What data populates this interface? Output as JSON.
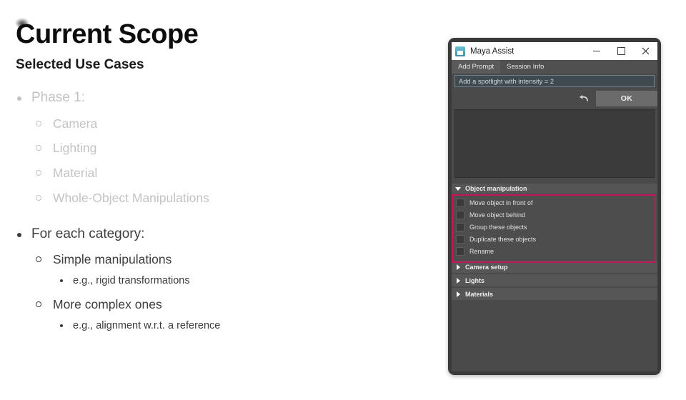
{
  "slide": {
    "title": "Current Scope",
    "subtitle": "Selected Use Cases",
    "bullets": {
      "phase1": {
        "label": "Phase 1:",
        "items": [
          "Camera",
          "Lighting",
          "Material",
          "Whole-Object Manipulations"
        ]
      },
      "each_category": {
        "label": "For each category:",
        "items": [
          {
            "label": "Simple manipulations",
            "sub": "e.g., rigid transformations"
          },
          {
            "label": "More complex ones",
            "sub": "e.g., alignment w.r.t. a reference"
          }
        ]
      }
    }
  },
  "app_window": {
    "title": "Maya Assist",
    "icon": "save-disk-icon",
    "window_controls": {
      "minimize": "minimize-icon",
      "maximize": "maximize-icon",
      "close": "close-icon"
    },
    "tabs": [
      {
        "label": "Add Prompt",
        "active": true
      },
      {
        "label": "Session Info",
        "active": false
      }
    ],
    "prompt_input": {
      "value": "Add a spotlight with intensity = 2",
      "placeholder": "Add a spotlight with intensity = 2"
    },
    "actions": {
      "undo_icon": "undo-arrow-icon",
      "ok_label": "OK"
    },
    "output_log": "",
    "sections": [
      {
        "title": "Object manipulation",
        "expanded": true,
        "highlighted": true,
        "items": [
          "Move object in front of",
          "Move object behind",
          "Group these objects",
          "Duplicate these objects",
          "Rename"
        ]
      },
      {
        "title": "Camera setup",
        "expanded": false,
        "items": []
      },
      {
        "title": "Lights",
        "expanded": false,
        "items": []
      },
      {
        "title": "Materials",
        "expanded": false,
        "items": []
      }
    ],
    "highlight_color": "#c2185b"
  }
}
